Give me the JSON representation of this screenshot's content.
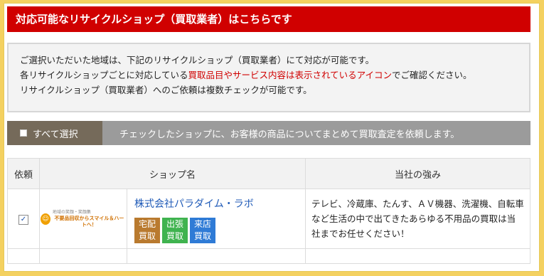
{
  "header": {
    "title": "対応可能なリサイクルショップ（買取業者）はこちらです"
  },
  "notice": {
    "line1": "ご選択いただいた地域は、下記のリサイクルショップ（買取業者）にて対応が可能です。",
    "line2_prefix": "各リサイクルショップごとに対応している",
    "line2_red": "買取品目やサービス内容は表示されているアイコン",
    "line2_suffix": "でご確認ください。",
    "line3": "リサイクルショップ（買取業者）へのご依頼は複数チェックが可能です。"
  },
  "select_bar": {
    "select_all_label": "すべて選択",
    "bulk_request_label": "チェックしたショップに、お客様の商品についてまとめて買取査定を依頼します。"
  },
  "table": {
    "headers": {
      "request": "依頼",
      "shop_name": "ショップ名",
      "strength": "当社の強み"
    },
    "rows": [
      {
        "checked": true,
        "check_mark": "✓",
        "logo": {
          "face": "☺",
          "small": "地域の笑顔・笑顔集",
          "main": "不要品回収からスマイル＆ハートへ！"
        },
        "shop_name": "株式会社パラダイム・ラボ",
        "services": [
          {
            "line1": "宅配",
            "line2": "買取",
            "color": "#b97a2f"
          },
          {
            "line1": "出張",
            "line2": "買取",
            "color": "#3fb34f"
          },
          {
            "line1": "来店",
            "line2": "買取",
            "color": "#2f7bd6"
          }
        ],
        "strength": "テレビ、冷蔵庫、たんす、ＡＶ機器、洗濯機、自転車など生活の中で出てきたあらゆる不用品の買取は当社までお任せください！"
      }
    ]
  }
}
